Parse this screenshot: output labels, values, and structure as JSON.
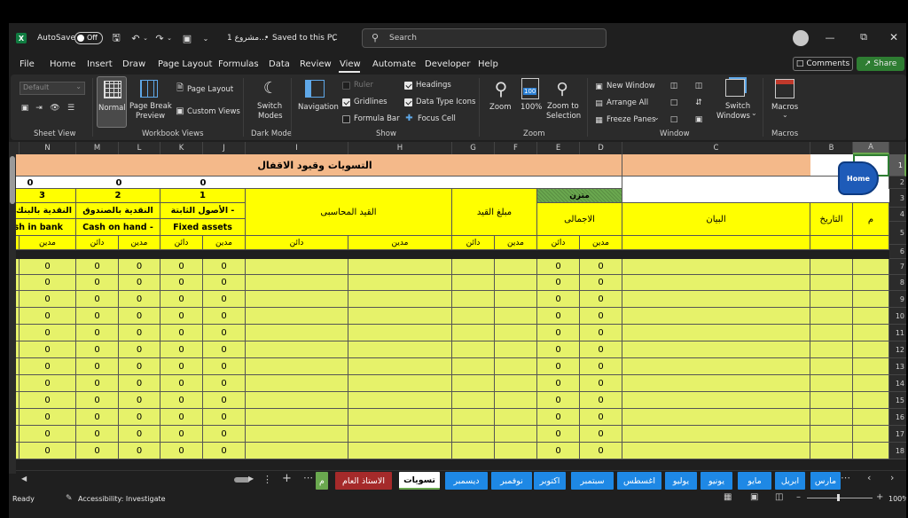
{
  "titlebar": {
    "autosave_label": "AutoSave",
    "autosave_state": "Off",
    "doc_title": "مشروع 1...",
    "saved_status": "Saved to this PC",
    "search_placeholder": "Search"
  },
  "menu_tabs": [
    "File",
    "Home",
    "Insert",
    "Draw",
    "Page Layout",
    "Formulas",
    "Data",
    "Review",
    "View",
    "Automate",
    "Developer",
    "Help"
  ],
  "active_tab": "View",
  "header_buttons": {
    "comments": "Comments",
    "share": "Share"
  },
  "ribbon": {
    "sheet_view": {
      "title": "Sheet View",
      "dropdown_value": "Default"
    },
    "workbook_views": {
      "title": "Workbook Views",
      "normal": "Normal",
      "page_break_1": "Page Break",
      "page_break_2": "Preview",
      "page_layout": "Page Layout",
      "custom_views": "Custom Views"
    },
    "dark_mode": {
      "title": "Dark Mode",
      "switch_1": "Switch",
      "switch_2": "Modes"
    },
    "show": {
      "title": "Show",
      "navigation": "Navigation",
      "ruler": "Ruler",
      "gridlines": "Gridlines",
      "formula_bar": "Formula Bar",
      "headings": "Headings",
      "data_type_icons": "Data Type Icons",
      "focus_cell": "Focus Cell"
    },
    "zoom": {
      "title": "Zoom",
      "zoom": "Zoom",
      "hundred": "100%",
      "zoom_sel_1": "Zoom to",
      "zoom_sel_2": "Selection",
      "badge": "100"
    },
    "window": {
      "title": "Window",
      "new_window": "New Window",
      "arrange_all": "Arrange All",
      "freeze_panes": "Freeze Panes",
      "switch_1": "Switch",
      "switch_2": "Windows"
    },
    "macros": {
      "title": "Macros",
      "macros": "Macros"
    }
  },
  "columns": [
    "N",
    "M",
    "L",
    "K",
    "J",
    "I",
    "H",
    "G",
    "F",
    "E",
    "D",
    "C",
    "B",
    "A"
  ],
  "rows": [
    "1",
    "2",
    "3",
    "4",
    "5",
    "6",
    "7",
    "8",
    "9",
    "10",
    "11",
    "12",
    "13",
    "14",
    "15",
    "16",
    "17",
    "18"
  ],
  "sheet": {
    "title": "التسويات وقيود الاقفال",
    "home_button": "Home",
    "totals": [
      "0",
      "0",
      "0"
    ],
    "balanced": "متزن",
    "group_numbers": [
      "3",
      "2",
      "1"
    ],
    "accounts_ar": [
      "النقدية بالبنك",
      "النقدية بالصندوق",
      "الأصول الثابتة -"
    ],
    "accounts_en": [
      "Cash in bank",
      "Cash on hand -",
      "Fixed assets"
    ],
    "journal_entry": "القيد المحاسبى",
    "entry_amount": "مبلغ القيد",
    "total": "الاجمالى",
    "description": "البيان",
    "date": "التاريخ",
    "num": "م",
    "debit": "مدين",
    "credit": "دائن",
    "zero": "0"
  },
  "sheet_tabs": [
    {
      "label": "م",
      "color": "#6aa84f"
    },
    {
      "label": "الاستاذ العام",
      "color": "#a52a2a"
    },
    {
      "label": "تسويات",
      "color": "#ffffff"
    },
    {
      "label": "ديسمبر",
      "color": "#1e88e5"
    },
    {
      "label": "نوفمبر",
      "color": "#1e88e5"
    },
    {
      "label": "اكتوبر",
      "color": "#1e88e5"
    },
    {
      "label": "سبتمبر",
      "color": "#1e88e5"
    },
    {
      "label": "اغسطس",
      "color": "#1e88e5"
    },
    {
      "label": "يوليو",
      "color": "#1e88e5"
    },
    {
      "label": "يونيو",
      "color": "#1e88e5"
    },
    {
      "label": "مايو",
      "color": "#1e88e5"
    },
    {
      "label": "ابريل",
      "color": "#1e88e5"
    },
    {
      "label": "مارس",
      "color": "#1e88e5"
    }
  ],
  "status": {
    "ready": "Ready",
    "accessibility": "Accessibility: Investigate",
    "zoom": "100%"
  }
}
